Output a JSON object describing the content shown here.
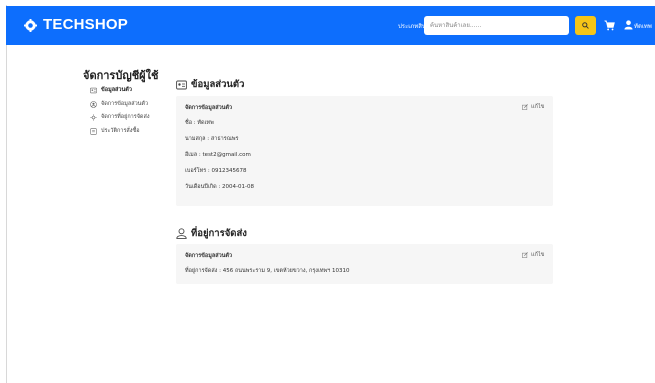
{
  "header": {
    "brand": "TECHSHOP",
    "nav_products": "ประเภทสินค้า",
    "search_placeholder": "ค้นหาสินค้าเลย......",
    "user_name": "ทัดเทพ",
    "colors": {
      "navbar": "#0d6efd",
      "search_button": "#f5c518"
    }
  },
  "sidebar": {
    "title": "จัดการบัญชีผู้ใช้",
    "items": [
      {
        "label": "ข้อมูลส่วนตัว",
        "icon": "id-card-icon"
      },
      {
        "label": "จัดการข้อมูลส่วนตัว",
        "icon": "user-circle-icon"
      },
      {
        "label": "จัดการที่อยู่การจัดส่ง",
        "icon": "location-icon"
      },
      {
        "label": "ประวัติการสั่งซื้อ",
        "icon": "receipt-icon"
      }
    ]
  },
  "personal": {
    "title": "ข้อมูลส่วนตัว",
    "card_heading": "จัดการข้อมูลส่วนตัว",
    "edit_label": "แก้ไข",
    "fields": [
      "ชื่อ : ทัดเทพ",
      "นามสกุล : สาธารณพร",
      "อีเมล : test2@gmail.com",
      "เบอร์โทร : 0912345678",
      "วันเดือนปีเกิด : 2004-01-08"
    ]
  },
  "address": {
    "title": "ที่อยู่การจัดส่ง",
    "card_heading": "จัดการข้อมูลส่วนตัว",
    "edit_label": "แก้ไข",
    "line": "ที่อยู่การจัดส่ง : 456 ถนนพระราม 9, เขตห้วยขวาง, กรุงเทพฯ 10310"
  }
}
